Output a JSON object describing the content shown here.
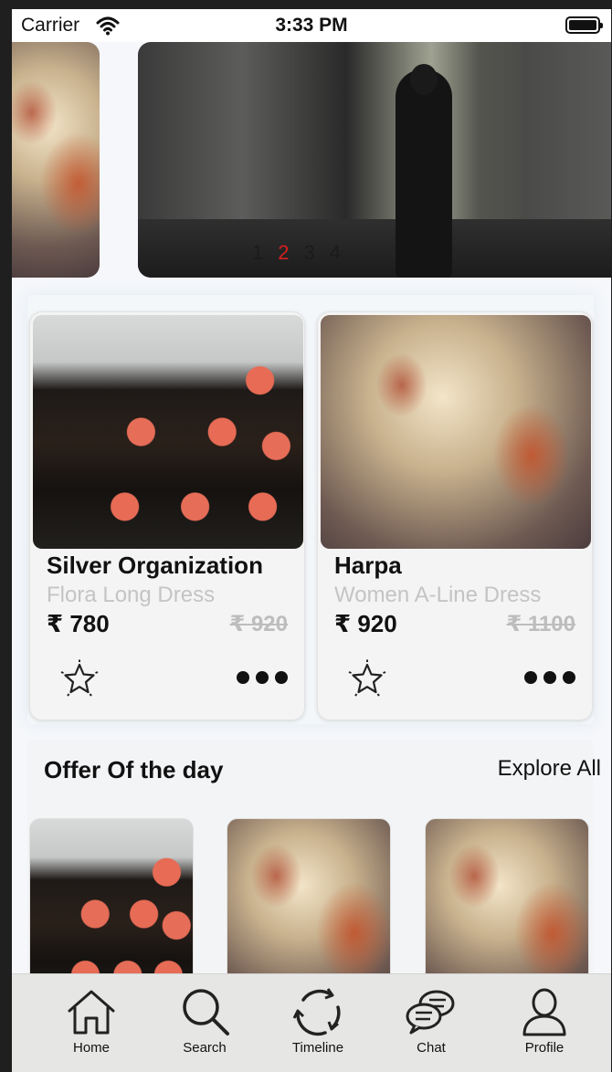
{
  "status_bar": {
    "carrier": "Carrier",
    "time": "3:33 PM",
    "wifi_icon": "wifi-icon",
    "battery_icon": "battery-icon"
  },
  "banner": {
    "pagination": [
      "1",
      "2",
      "3",
      "4"
    ],
    "active_page": "2",
    "active_color": "#d4201c"
  },
  "products": [
    {
      "title": "Silver Organization",
      "subtitle": "Flora Long Dress",
      "price": "₹ 780",
      "mrp": "₹ 920",
      "favorite_icon": "star-icon",
      "more_icon": "more-icon"
    },
    {
      "title": "Harpa",
      "subtitle": "Women A-Line Dress",
      "price": "₹ 920",
      "mrp": "₹ 1100",
      "favorite_icon": "star-icon",
      "more_icon": "more-icon"
    }
  ],
  "offer": {
    "heading": "Offer Of the day",
    "explore_label": "Explore All"
  },
  "tabbar": {
    "items": [
      {
        "label": "Home",
        "icon": "home-icon"
      },
      {
        "label": "Search",
        "icon": "search-icon"
      },
      {
        "label": "Timeline",
        "icon": "refresh-icon"
      },
      {
        "label": "Chat",
        "icon": "chat-icon"
      },
      {
        "label": "Profile",
        "icon": "profile-icon"
      }
    ]
  }
}
